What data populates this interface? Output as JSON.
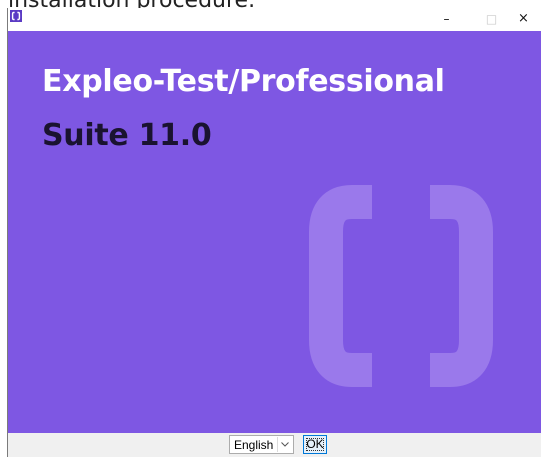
{
  "background": {
    "caption_text": "installation procedure."
  },
  "window": {
    "icon": "installer-app-icon",
    "controls": {
      "minimize": "–",
      "maximize": "□",
      "close": "×"
    }
  },
  "banner": {
    "title": "Expleo-Test/Professional",
    "suite": "Suite 11.0",
    "background_color": "#7e57e3",
    "watermark_icon": "brackets-logo-icon"
  },
  "footer": {
    "language": {
      "selected": "English",
      "icon": "chevron-down-icon"
    },
    "ok_label": "OK"
  }
}
